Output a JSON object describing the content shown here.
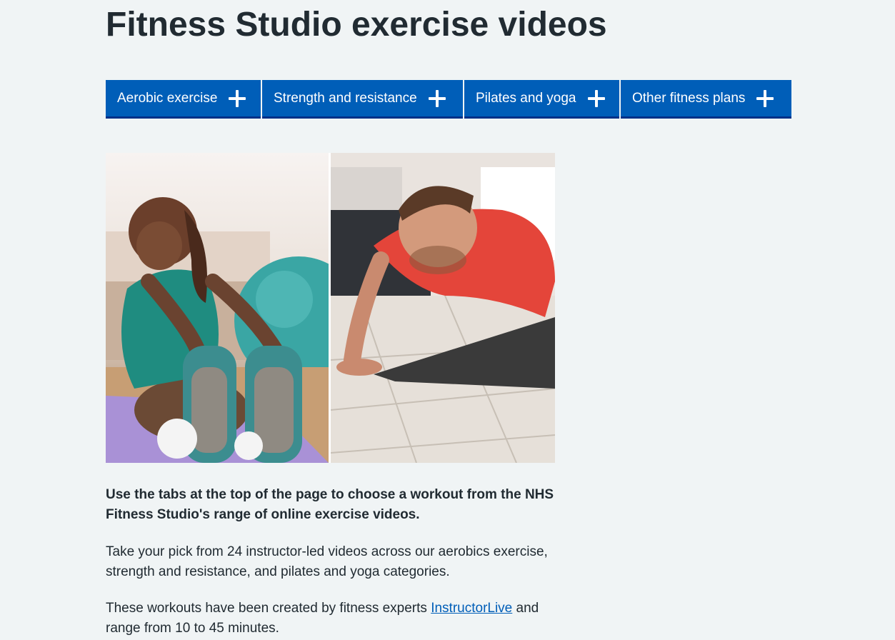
{
  "page": {
    "title": "Fitness Studio exercise videos"
  },
  "tabs": [
    {
      "label": "Aerobic exercise",
      "icon": "plus-icon"
    },
    {
      "label": "Strength and resistance",
      "icon": "plus-icon"
    },
    {
      "label": "Pilates and yoga",
      "icon": "plus-icon"
    },
    {
      "label": "Other fitness plans",
      "icon": "plus-icon"
    }
  ],
  "content": {
    "lead": "Use the tabs at the top of the page to choose a workout from the NHS Fitness Studio's range of online exercise videos.",
    "paragraph1": "Take your pick from 24 instructor-led videos across our aerobics exercise, strength and resistance, and pilates and yoga categories.",
    "paragraph2_before": "These workouts have been created by fitness experts ",
    "paragraph2_link": "InstructorLive",
    "paragraph2_after": " and range from 10 to 45 minutes."
  },
  "colors": {
    "background": "#f0f4f5",
    "tab_background": "#005eb8",
    "tab_border": "#003087",
    "link": "#005eb8",
    "text": "#212b32"
  }
}
